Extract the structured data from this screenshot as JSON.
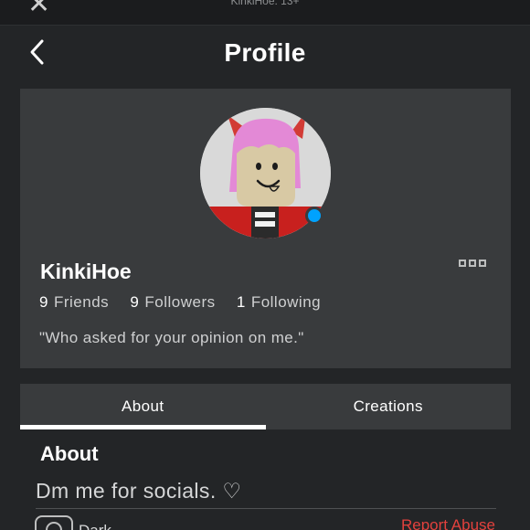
{
  "status_bar": {
    "close_glyph": "✕",
    "subtitle": "KinkiHoe: 13+"
  },
  "header": {
    "title": "Profile",
    "back_icon": "chevron-left-icon"
  },
  "profile": {
    "username": "KinkiHoe",
    "online_color": "#00a2ff",
    "friends": {
      "count": "9",
      "label": "Friends"
    },
    "followers": {
      "count": "9",
      "label": "Followers"
    },
    "following": {
      "count": "1",
      "label": "Following"
    },
    "status": "\"Who asked for your opinion on me.\"",
    "more_icon": "more-options-icon"
  },
  "tabs": [
    {
      "label": "About",
      "active": true
    },
    {
      "label": "Creations",
      "active": false
    }
  ],
  "about": {
    "heading": "About",
    "text": "Dm me for socials. ♡"
  },
  "footer": {
    "left_label": "Dark",
    "report_label": "Report Abuse",
    "report_color": "#e2413d"
  }
}
